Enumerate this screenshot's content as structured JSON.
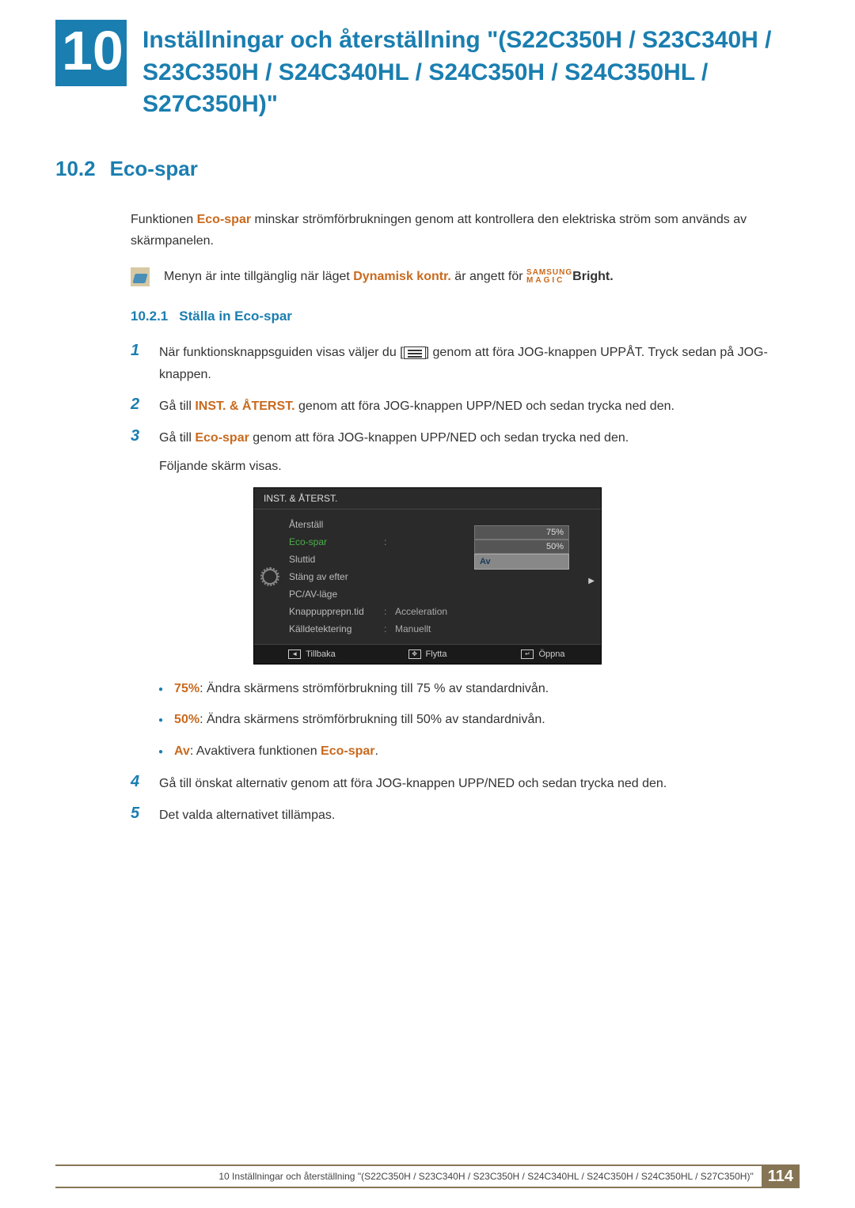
{
  "chapter": {
    "number": "10",
    "title": "Inställningar och återställning \"(S22C350H / S23C340H / S23C350H / S24C340HL / S24C350H / S24C350HL / S27C350H)\""
  },
  "section": {
    "number": "10.2",
    "title": "Eco-spar"
  },
  "intro": {
    "pre": "Funktionen ",
    "hl": "Eco-spar",
    "post": " minskar strömförbrukningen genom att kontrollera den elektriska ström som används av skärmpanelen."
  },
  "info": {
    "pre": "Menyn är inte tillgänglig när läget ",
    "hl": "Dynamisk kontr.",
    "mid": " är angett för ",
    "magic_top": "SAMSUNG",
    "magic_bot": "MAGIC",
    "post": "Bright."
  },
  "subsection": {
    "number": "10.2.1",
    "title": "Ställa in Eco-spar"
  },
  "steps": {
    "s1": {
      "num": "1",
      "pre": "När funktionsknappsguiden visas väljer du [",
      "post": "] genom att föra JOG-knappen UPPÅT. Tryck sedan på JOG-knappen."
    },
    "s2": {
      "num": "2",
      "pre": "Gå till ",
      "hl": "INST. & ÅTERST.",
      "post": " genom att föra JOG-knappen UPP/NED och sedan trycka ned den."
    },
    "s3": {
      "num": "3",
      "pre": "Gå till ",
      "hl": "Eco-spar",
      "post": " genom att föra JOG-knappen UPP/NED och sedan trycka ned den.",
      "extra": "Följande skärm visas."
    },
    "s4": {
      "num": "4",
      "text": "Gå till önskat alternativ genom att föra JOG-knappen UPP/NED och sedan trycka ned den."
    },
    "s5": {
      "num": "5",
      "text": "Det valda alternativet tillämpas."
    }
  },
  "osd": {
    "title": "INST. & ÅTERST.",
    "items": {
      "reset": "Återställ",
      "eco": "Eco-spar",
      "timer": "Sluttid",
      "off_after": "Stäng av efter",
      "pcav": "PC/AV-läge",
      "keyrep": "Knappupprepn.tid",
      "keyrep_val": "Acceleration",
      "srcdet": "Källdetektering",
      "srcdet_val": "Manuellt"
    },
    "dropdown": {
      "opt1": "75%",
      "opt2": "50%",
      "sel": "Av"
    },
    "footer": {
      "back": "Tillbaka",
      "move": "Flytta",
      "open": "Öppna"
    }
  },
  "bullets": {
    "b1": {
      "hl": "75%",
      "text": ": Ändra skärmens strömförbrukning till 75 % av standardnivån."
    },
    "b2": {
      "hl": "50%",
      "text": ": Ändra skärmens strömförbrukning till 50% av standardnivån."
    },
    "b3": {
      "hl": "Av",
      "mid": ": Avaktivera funktionen ",
      "hl2": "Eco-spar",
      "post": "."
    }
  },
  "footer": {
    "text": "10 Inställningar och återställning \"(S22C350H / S23C340H / S23C350H / S24C340HL / S24C350H / S24C350HL / S27C350H)\"",
    "page": "114"
  }
}
